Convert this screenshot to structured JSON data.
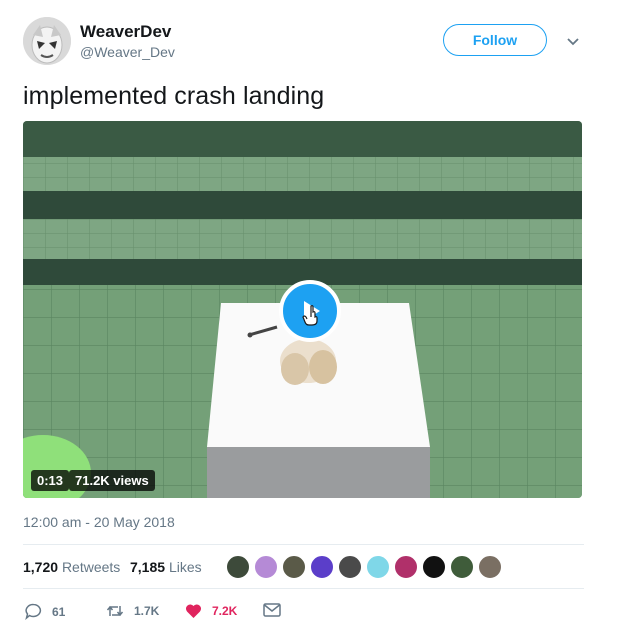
{
  "user": {
    "display_name": "WeaverDev",
    "handle": "@Weaver_Dev",
    "avatar_icon": "clown-avatar-icon"
  },
  "follow_label": "Follow",
  "menu_icon": "chevron-down-icon",
  "tweet_text": "implemented crash landing",
  "video": {
    "duration": "0:13",
    "views": "71.2K views",
    "play_icon": "play-icon"
  },
  "timestamp": "12:00 am - 20 May 2018",
  "stats": {
    "retweets_count": "1,720",
    "retweets_label": "Retweets",
    "likes_count": "7,185",
    "likes_label": "Likes",
    "liker_avatar_count": 10
  },
  "actions": {
    "reply_icon": "reply-icon",
    "reply_count": "61",
    "retweet_icon": "retweet-icon",
    "retweet_count": "1.7K",
    "like_icon": "heart-icon",
    "like_count": "7.2K",
    "message_icon": "envelope-icon"
  },
  "colors": {
    "accent": "#1da1f2",
    "like": "#e0245e",
    "muted": "#657786",
    "grass": "#6f9a72",
    "dark_band": "#2f4a3a"
  }
}
